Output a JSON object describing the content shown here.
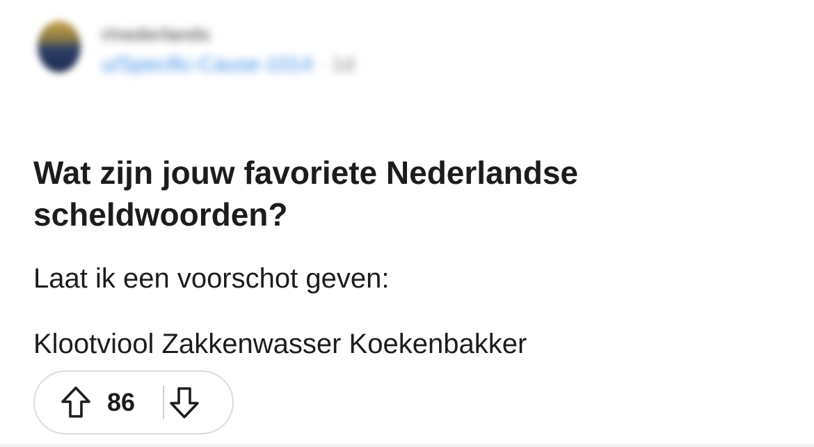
{
  "header": {
    "community": "r/nederlands",
    "author": "u/Specific-Cause-1014",
    "separator": "·",
    "age": "1d"
  },
  "post": {
    "title": "Wat zijn jouw favoriete Nederlandse scheldwoorden?",
    "body": [
      "Laat ik een voorschot geven:",
      "Klootviool Zakkenwasser Koekenbakker"
    ]
  },
  "votes": {
    "count": "86"
  },
  "icons": {
    "upvote": "arrow-up-icon",
    "downvote": "arrow-down-icon"
  },
  "colors": {
    "text": "#1c1c1c",
    "author_link": "#3a8be8",
    "pill_border": "#dcdcdc"
  }
}
